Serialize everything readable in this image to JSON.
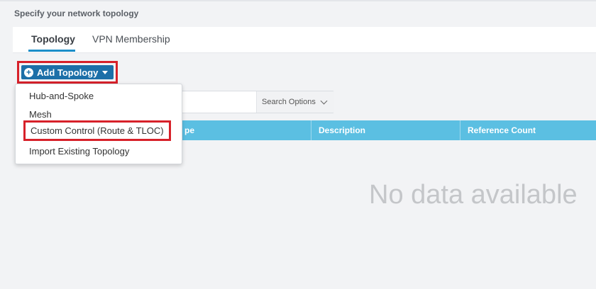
{
  "page": {
    "heading": "Specify your network topology"
  },
  "tabs": [
    {
      "label": "Topology",
      "active": true
    },
    {
      "label": "VPN Membership",
      "active": false
    }
  ],
  "toolbar": {
    "add_button_label": "Add Topology",
    "highlight_color": "#d7212a",
    "button_color": "#1c6fa8"
  },
  "dropdown": {
    "items": [
      {
        "label": "Hub-and-Spoke"
      },
      {
        "label": "Mesh"
      },
      {
        "label": "Custom Control (Route & TLOC)"
      },
      {
        "label": "Import Existing Topology"
      }
    ]
  },
  "search": {
    "options_label": "Search Options"
  },
  "table": {
    "columns": [
      "pe",
      "Description",
      "Reference Count"
    ],
    "header_color": "#5bbfe2",
    "empty_message": "No data available"
  }
}
